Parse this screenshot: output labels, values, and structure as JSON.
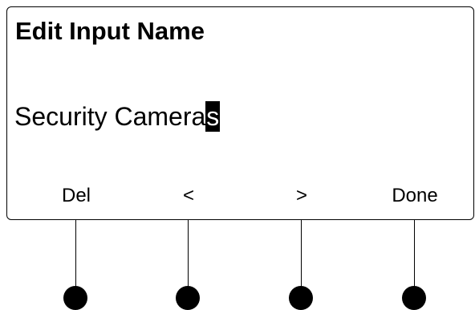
{
  "screen": {
    "title": "Edit Input Name",
    "input_name": {
      "text_before_cursor": "Security Camera",
      "cursor_char": "s"
    }
  },
  "softkeys": [
    {
      "label": "Del"
    },
    {
      "label": "<"
    },
    {
      "label": ">"
    },
    {
      "label": "Done"
    }
  ]
}
